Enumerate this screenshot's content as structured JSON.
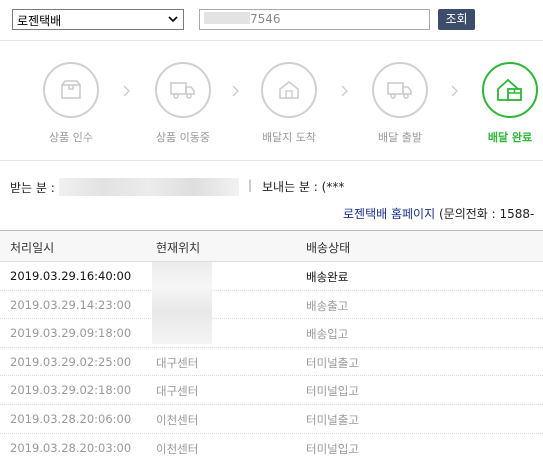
{
  "search": {
    "courier": "로젠택배",
    "tracking_suffix": "7546",
    "lookup_label": "조회"
  },
  "steps": [
    {
      "label": "상품 인수",
      "icon": "box-icon"
    },
    {
      "label": "상품 이동중",
      "icon": "truck-icon"
    },
    {
      "label": "배달지 도착",
      "icon": "house-icon"
    },
    {
      "label": "배달 출발",
      "icon": "truck-icon"
    },
    {
      "label": "배달 완료",
      "icon": "delivered-house-icon",
      "active": true
    }
  ],
  "info": {
    "receiver_label": "받는 분 :",
    "separator": "|",
    "sender_label": "보내는 분 :",
    "sender_value": "(***",
    "homepage_link": "로젠택배 홈페이지",
    "phone_text": "(문의전화 : 1588-"
  },
  "table": {
    "headers": [
      "처리일시",
      "현재위치",
      "배송상태"
    ],
    "rows": [
      {
        "time": "2019.03.29.16:40:00",
        "location": "",
        "status": "배송완료"
      },
      {
        "time": "2019.03.29.14:23:00",
        "location": "",
        "status": "배송출고"
      },
      {
        "time": "2019.03.29.09:18:00",
        "location": "",
        "status": "배송입고"
      },
      {
        "time": "2019.03.29.02:25:00",
        "location": "대구센터",
        "status": "터미널출고"
      },
      {
        "time": "2019.03.29.02:18:00",
        "location": "대구센터",
        "status": "터미널입고"
      },
      {
        "time": "2019.03.28.20:06:00",
        "location": "이천센터",
        "status": "터미널출고"
      },
      {
        "time": "2019.03.28.20:03:00",
        "location": "이천센터",
        "status": "터미널입고"
      }
    ]
  },
  "colors": {
    "accent": "#2db736",
    "button": "#3d4c6b",
    "link": "#1b2f8a"
  }
}
